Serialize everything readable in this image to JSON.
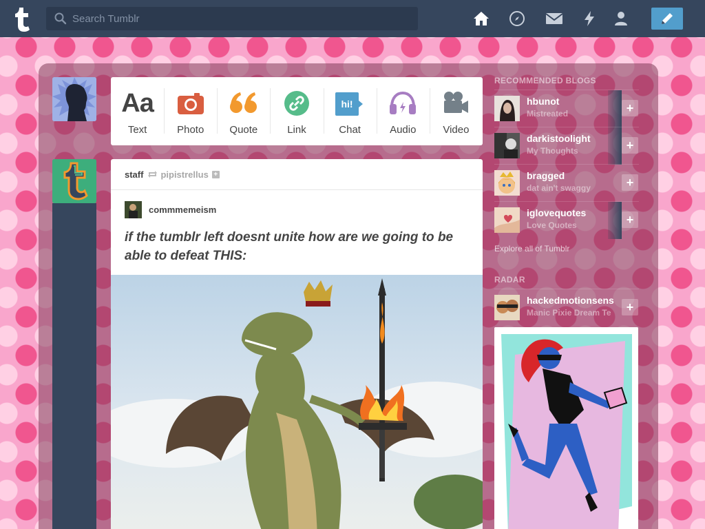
{
  "header": {
    "search_placeholder": "Search Tumblr",
    "nav": [
      "home-icon",
      "explore-compass-icon",
      "inbox-mail-icon",
      "activity-lightning-icon",
      "account-person-icon"
    ],
    "compose": "compose-pencil-icon"
  },
  "post_types": [
    {
      "label": "Text",
      "icon": "text-aa-icon",
      "color": "#444444"
    },
    {
      "label": "Photo",
      "icon": "camera-icon",
      "color": "#d95e40"
    },
    {
      "label": "Quote",
      "icon": "quote-icon",
      "color": "#f2992e"
    },
    {
      "label": "Link",
      "icon": "link-icon",
      "color": "#56bc8a"
    },
    {
      "label": "Chat",
      "icon": "chat-icon",
      "color": "#529ecc"
    },
    {
      "label": "Audio",
      "icon": "headphones-icon",
      "color": "#a77dc2"
    },
    {
      "label": "Video",
      "icon": "video-camera-icon",
      "color": "#748089"
    }
  ],
  "post": {
    "author": "staff",
    "reblogged_from": "pipistrellus",
    "source_blog": "commmemeism",
    "title": "if the tumblr left doesnt unite how are we going to be able to defeat THIS:"
  },
  "sidebar": {
    "recommended_heading": "RECOMMENDED BLOGS",
    "blogs": [
      {
        "name": "hbunot",
        "title": "Mistreated"
      },
      {
        "name": "darkistoolight",
        "title": "My Thoughts"
      },
      {
        "name": "bragged",
        "title": "dat ain't swaggy"
      },
      {
        "name": "iglovequotes",
        "title": "Love Quotes"
      }
    ],
    "explore_link": "Explore all of Tumblr",
    "radar_heading": "RADAR",
    "radar_blog": {
      "name": "hackedmotionsens",
      "title": "Manic Pixie Dream Te"
    }
  },
  "colors": {
    "header_bg": "#36465d",
    "accent": "#529ecc",
    "bg_pink": "#f9a6cc"
  }
}
